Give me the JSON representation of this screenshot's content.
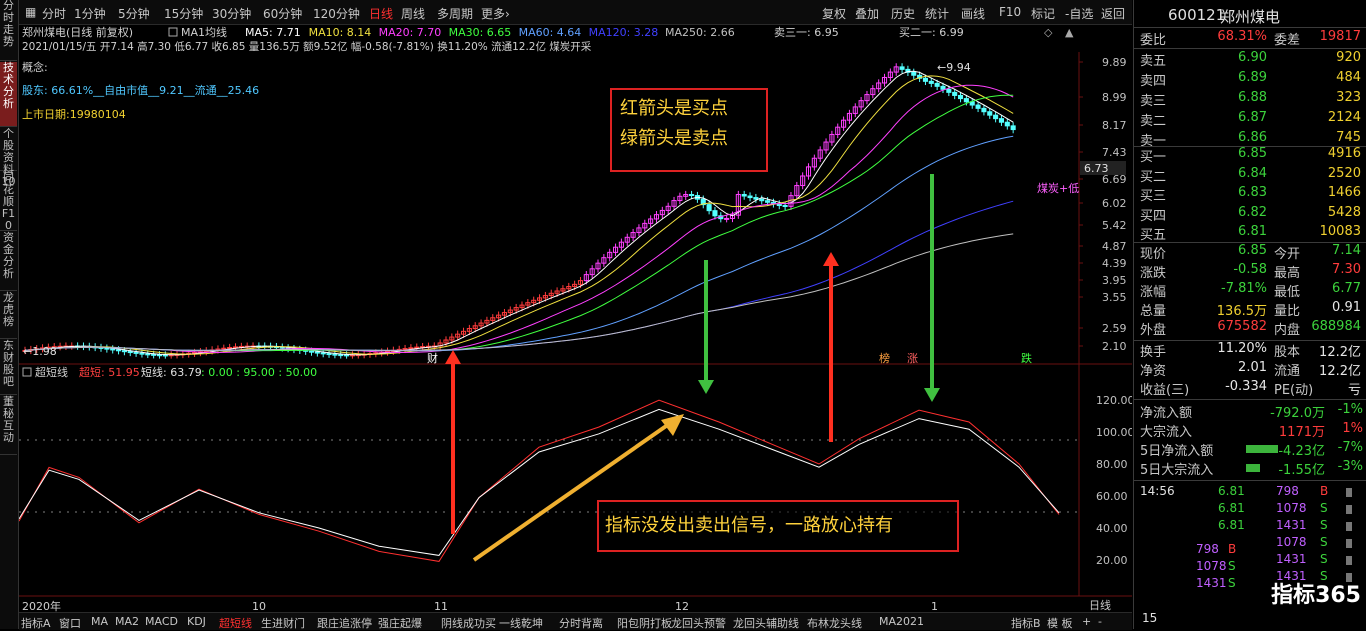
{
  "left_tabs": [
    "分时走势",
    "技术分析",
    "个股资料10",
    "同花顺F10",
    "资金分析",
    "龙虎榜",
    "东财股吧",
    "董秘互动"
  ],
  "toolbar": {
    "periods": [
      "分时",
      "1分钟",
      "5分钟",
      "15分钟",
      "30分钟",
      "60分钟",
      "120分钟",
      "日线",
      "周线",
      "多周期",
      "更多›"
    ],
    "active_period": "日线",
    "right": [
      "复权",
      "叠加",
      "历史",
      "统计",
      "画线",
      "F10",
      "标记",
      "-自选",
      "返回"
    ]
  },
  "header": {
    "line1": "郑州煤电(日线 前复权)",
    "ma_label": "MA1均线",
    "ma_values": [
      {
        "text": "MA5: 7.71",
        "color": "#ffffff"
      },
      {
        "text": "MA10: 8.14",
        "color": "#f0e040"
      },
      {
        "text": "MA20: 7.70",
        "color": "#ff40ff"
      },
      {
        "text": "MA30: 6.65",
        "color": "#40ff40"
      },
      {
        "text": "MA60: 4.64",
        "color": "#60a0ff"
      },
      {
        "text": "MA120: 3.28",
        "color": "#4040ff"
      },
      {
        "text": "MA250: 2.66",
        "color": "#c0c0c0"
      }
    ],
    "line2": "2021/01/15/五 开7.14 高7.30 低6.77 收6.85 量136.5万 额9.52亿 幅-0.58(-7.81%) 换11.20% 流通12.2亿 煤炭开采",
    "sell1": "卖三一: 6.95",
    "buy1": "买二一: 6.99",
    "concept": "概念:",
    "shareholders": "股东:     66.61%__自由市值__9.21__流通__25.46",
    "list_date": "上市日期:19980104"
  },
  "price_axis": [
    "9.89",
    "8.99",
    "8.17",
    "7.43",
    "6.69",
    "6.02",
    "5.42",
    "4.87",
    "4.39",
    "3.95",
    "3.55",
    "2.59",
    "2.10"
  ],
  "last_price_tag": "6.73",
  "high_label": "9.94",
  "low_label": "1.98",
  "sector_tag": "煤炭+低",
  "event_tags": [
    "财",
    "榜",
    "涨",
    "跌"
  ],
  "indicator": {
    "name": "超短线",
    "v1_label": "超短: 51.95",
    "v2_label": "短线: 63.79",
    "v3": ": 0.00 : 95.00 : 50.00",
    "axis": [
      "120.00",
      "100.00",
      "80.00",
      "60.00",
      "40.00",
      "20.00"
    ]
  },
  "time_axis": [
    "2020年",
    "10",
    "11",
    "12",
    "1"
  ],
  "annotations": {
    "box1_line1": "红箭头是买点",
    "box1_line2": "绿箭头是卖点",
    "box2": "指标没发出卖出信号，一路放心持有"
  },
  "bottom_tabs": [
    "指标A",
    "窗口",
    "MA",
    "MA2",
    "MACD",
    "KDJ",
    "超短线",
    "生进财门",
    "跟庄追涨停",
    "强庄起爆",
    "阴线成功买",
    "一线乾坤",
    "分时背离",
    "阳包阴打板",
    "龙回头预警",
    "龙回头辅助线",
    "布林龙头线",
    "MA2021"
  ],
  "bottom_active": "超短线",
  "bottom_right": [
    "指标B",
    "模 板",
    "+",
    "-"
  ],
  "bottom_right_period": "日线",
  "quote": {
    "code": "600121",
    "name": "郑州煤电",
    "weibi_label": "委比",
    "weibi": "68.31%",
    "weicha_label": "委差",
    "weicha": "19817",
    "sells": [
      {
        "label": "卖五",
        "price": "6.90",
        "vol": "920"
      },
      {
        "label": "卖四",
        "price": "6.89",
        "vol": "484"
      },
      {
        "label": "卖三",
        "price": "6.88",
        "vol": "323"
      },
      {
        "label": "卖二",
        "price": "6.87",
        "vol": "2124"
      },
      {
        "label": "卖一",
        "price": "6.86",
        "vol": "745"
      }
    ],
    "buys": [
      {
        "label": "买一",
        "price": "6.85",
        "vol": "4916"
      },
      {
        "label": "买二",
        "price": "6.84",
        "vol": "2520"
      },
      {
        "label": "买三",
        "price": "6.83",
        "vol": "1466"
      },
      {
        "label": "买四",
        "price": "6.82",
        "vol": "5428"
      },
      {
        "label": "买五",
        "price": "6.81",
        "vol": "10083"
      }
    ],
    "stats": [
      {
        "l1": "现价",
        "v1": "6.85",
        "c1": "green",
        "l2": "今开",
        "v2": "7.14",
        "c2": "green"
      },
      {
        "l1": "涨跌",
        "v1": "-0.58",
        "c1": "green",
        "l2": "最高",
        "v2": "7.30",
        "c2": "red"
      },
      {
        "l1": "涨幅",
        "v1": "-7.81%",
        "c1": "green",
        "l2": "最低",
        "v2": "6.77",
        "c2": "green"
      },
      {
        "l1": "总量",
        "v1": "136.5万",
        "c1": "yellow",
        "l2": "量比",
        "v2": "0.91",
        "c2": "white"
      },
      {
        "l1": "外盘",
        "v1": "675582",
        "c1": "red",
        "l2": "内盘",
        "v2": "688984",
        "c2": "green"
      }
    ],
    "stats2": [
      {
        "l1": "换手",
        "v1": "11.20%",
        "l2": "股本",
        "v2": "12.2亿"
      },
      {
        "l1": "净资",
        "v1": "2.01",
        "l2": "流通",
        "v2": "12.2亿"
      },
      {
        "l1": "收益(三)",
        "v1": "-0.334",
        "l2": "PE(动)",
        "v2": "亏"
      }
    ],
    "flows": [
      {
        "label": "净流入额",
        "value": "-792.0万",
        "pct": "-1%",
        "color": "green"
      },
      {
        "label": "大宗流入",
        "value": "1171万",
        "pct": "1%",
        "color": "red"
      },
      {
        "label": "5日净流入额",
        "value": "-4.23亿",
        "pct": "-7%",
        "color": "green"
      },
      {
        "label": "5日大宗流入",
        "value": "-1.55亿",
        "pct": "-3%",
        "color": "green"
      }
    ],
    "ticks": [
      {
        "time": "14:56",
        "price": "6.81",
        "vol": "798",
        "dir": "B"
      },
      {
        "time": "",
        "price": "6.81",
        "vol": "1078",
        "dir": "S"
      },
      {
        "time": "",
        "price": "6.81",
        "vol": "1431",
        "dir": "S"
      },
      {
        "time": "",
        "price": "",
        "vol": "1078",
        "dir": "S"
      },
      {
        "time": "",
        "price": "",
        "vol": "1431",
        "dir": "S"
      },
      {
        "time": "",
        "price": "",
        "vol": "1431",
        "dir": "S"
      }
    ],
    "ticks2": [
      {
        "vol": "798",
        "dir": "B"
      },
      {
        "vol": "1078",
        "dir": "S"
      },
      {
        "vol": "1431",
        "dir": "S"
      }
    ],
    "bottom_code": "15",
    "logo": "指标365"
  },
  "colors": {
    "up": "#ff3c3c",
    "down": "#54ffff",
    "accent": "#ff3030",
    "bg": "#000000"
  }
}
